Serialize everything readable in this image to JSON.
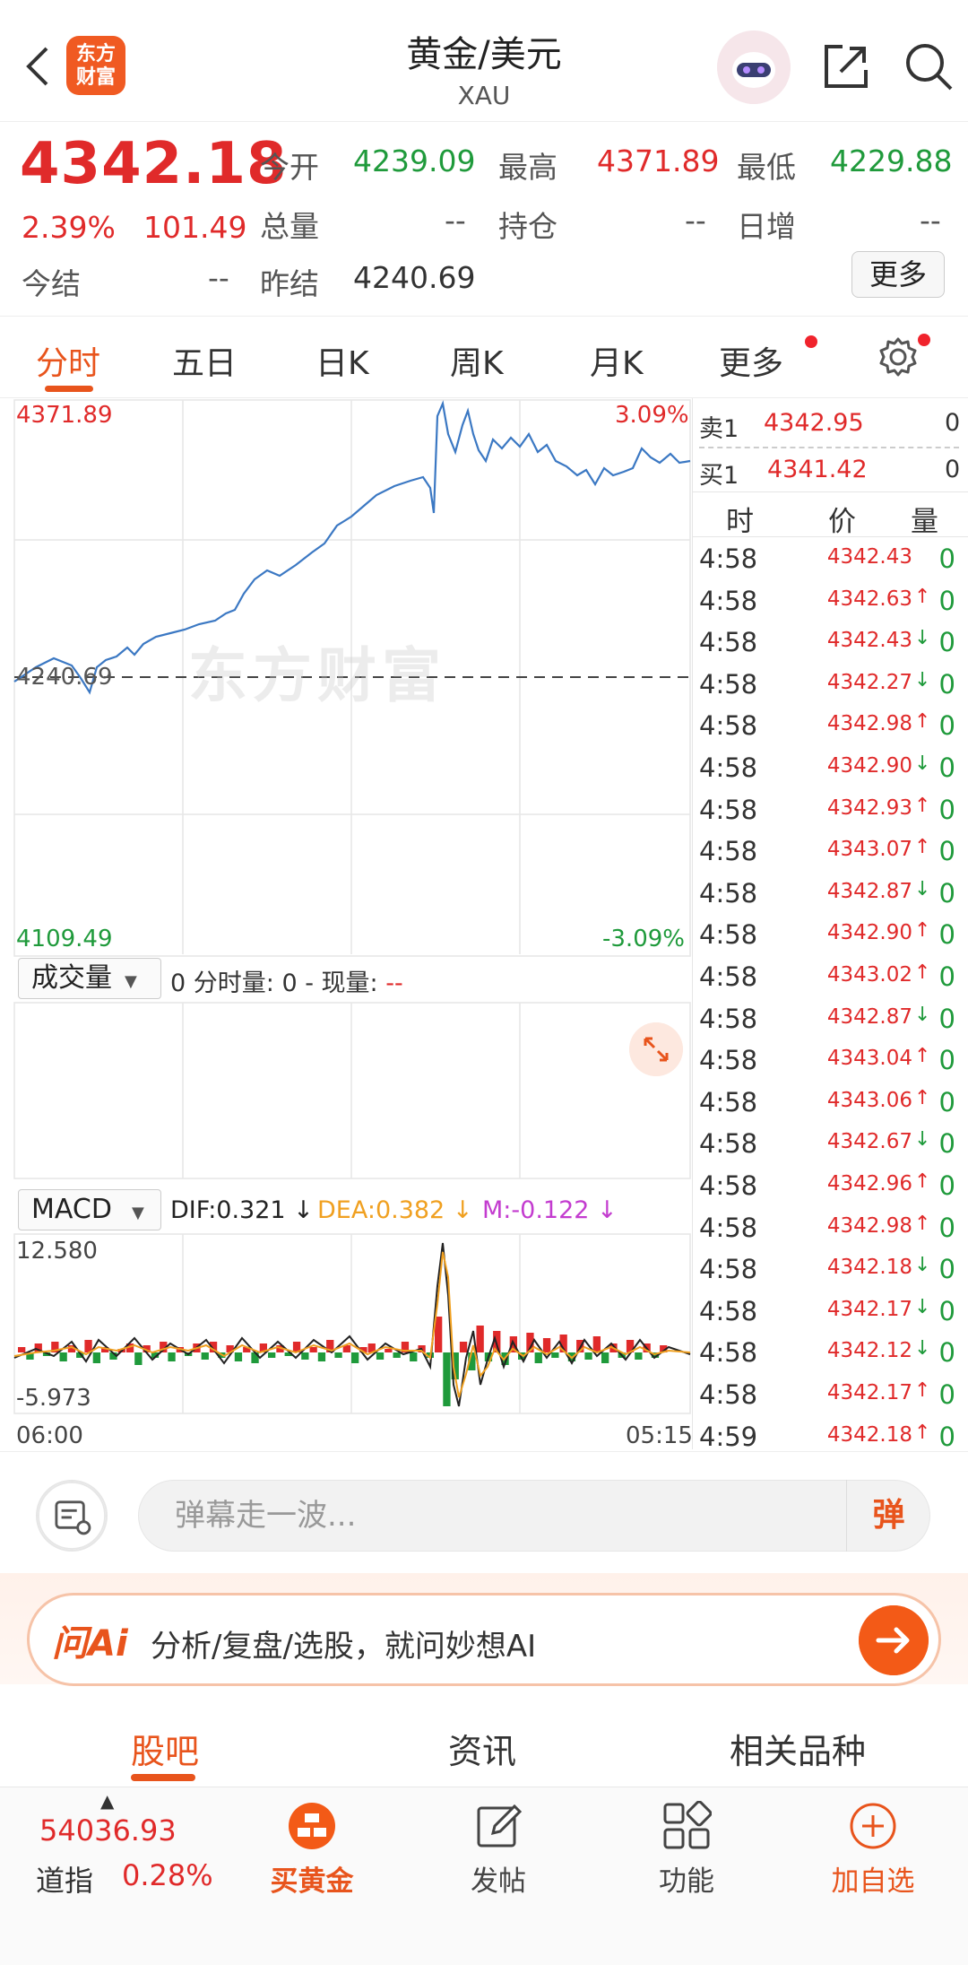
{
  "header": {
    "title": "黄金/美元",
    "subtitle": "XAU",
    "logo_line1": "东方",
    "logo_line2": "财富"
  },
  "quote": {
    "price": "4342.18",
    "change_pct": "2.39%",
    "change_abs": "101.49",
    "open_label": "今开",
    "open": "4239.09",
    "high_label": "最高",
    "high": "4371.89",
    "low_label": "最低",
    "low": "4229.88",
    "volume_label": "总量",
    "volume": "--",
    "position_label": "持仓",
    "position": "--",
    "daily_inc_label": "日增",
    "daily_inc": "--",
    "settle_label": "今结",
    "settle": "--",
    "prev_settle_label": "昨结",
    "prev_settle": "4240.69",
    "more_label": "更多"
  },
  "tabs": [
    "分时",
    "五日",
    "日K",
    "周K",
    "月K",
    "更多"
  ],
  "chart": {
    "top_price": "4371.89",
    "bottom_price": "4109.49",
    "top_pct": "3.09%",
    "bottom_pct": "-3.09%",
    "ref_price": "4240.69",
    "watermark": "东方财富",
    "start_time": "06:00",
    "end_time": "05:15"
  },
  "volume": {
    "selector": "成交量",
    "info_prefix": "0 分时量: 0 - 现量: ",
    "info_value": "--"
  },
  "macd": {
    "selector": "MACD",
    "dif": "DIF:0.321 ↓",
    "dea": "DEA:0.382 ↓",
    "m": "M:-0.122 ↓",
    "top": "12.580",
    "bottom": "-5.973"
  },
  "orderbook": {
    "ask_label": "卖1",
    "ask_price": "4342.95",
    "ask_vol": "0",
    "bid_label": "买1",
    "bid_price": "4341.42",
    "bid_vol": "0"
  },
  "ticks_header": {
    "time": "时",
    "price": "价",
    "vol": "量"
  },
  "ticks": [
    {
      "t": "4:58",
      "p": "4342.43",
      "a": "",
      "v": "0"
    },
    {
      "t": "4:58",
      "p": "4342.63",
      "a": "↑",
      "v": "0"
    },
    {
      "t": "4:58",
      "p": "4342.43",
      "a": "↓",
      "v": "0"
    },
    {
      "t": "4:58",
      "p": "4342.27",
      "a": "↓",
      "v": "0"
    },
    {
      "t": "4:58",
      "p": "4342.98",
      "a": "↑",
      "v": "0"
    },
    {
      "t": "4:58",
      "p": "4342.90",
      "a": "↓",
      "v": "0"
    },
    {
      "t": "4:58",
      "p": "4342.93",
      "a": "↑",
      "v": "0"
    },
    {
      "t": "4:58",
      "p": "4343.07",
      "a": "↑",
      "v": "0"
    },
    {
      "t": "4:58",
      "p": "4342.87",
      "a": "↓",
      "v": "0"
    },
    {
      "t": "4:58",
      "p": "4342.90",
      "a": "↑",
      "v": "0"
    },
    {
      "t": "4:58",
      "p": "4343.02",
      "a": "↑",
      "v": "0"
    },
    {
      "t": "4:58",
      "p": "4342.87",
      "a": "↓",
      "v": "0"
    },
    {
      "t": "4:58",
      "p": "4343.04",
      "a": "↑",
      "v": "0"
    },
    {
      "t": "4:58",
      "p": "4343.06",
      "a": "↑",
      "v": "0"
    },
    {
      "t": "4:58",
      "p": "4342.67",
      "a": "↓",
      "v": "0"
    },
    {
      "t": "4:58",
      "p": "4342.96",
      "a": "↑",
      "v": "0"
    },
    {
      "t": "4:58",
      "p": "4342.98",
      "a": "↑",
      "v": "0"
    },
    {
      "t": "4:58",
      "p": "4342.18",
      "a": "↓",
      "v": "0"
    },
    {
      "t": "4:58",
      "p": "4342.17",
      "a": "↓",
      "v": "0"
    },
    {
      "t": "4:58",
      "p": "4342.12",
      "a": "↓",
      "v": "0"
    },
    {
      "t": "4:58",
      "p": "4342.17",
      "a": "↑",
      "v": "0"
    },
    {
      "t": "4:59",
      "p": "4342.18",
      "a": "↑",
      "v": "0"
    }
  ],
  "danmu": {
    "placeholder": "弹幕走一波...",
    "button": "弹"
  },
  "ai": {
    "logo": "问Ai",
    "text": "分析/复盘/选股，就问妙想AI"
  },
  "sections": [
    "股吧",
    "资讯",
    "相关品种"
  ],
  "bottom": {
    "index_value": "54036.93",
    "index_name": "道指",
    "index_pct": "0.28%",
    "buy_gold": "买黄金",
    "post": "发帖",
    "function": "功能",
    "add_watch": "加自选"
  },
  "colors": {
    "up": "#e02a2a",
    "down": "#1f9a3b",
    "accent": "#e8541c",
    "line": "#3b78c3"
  }
}
